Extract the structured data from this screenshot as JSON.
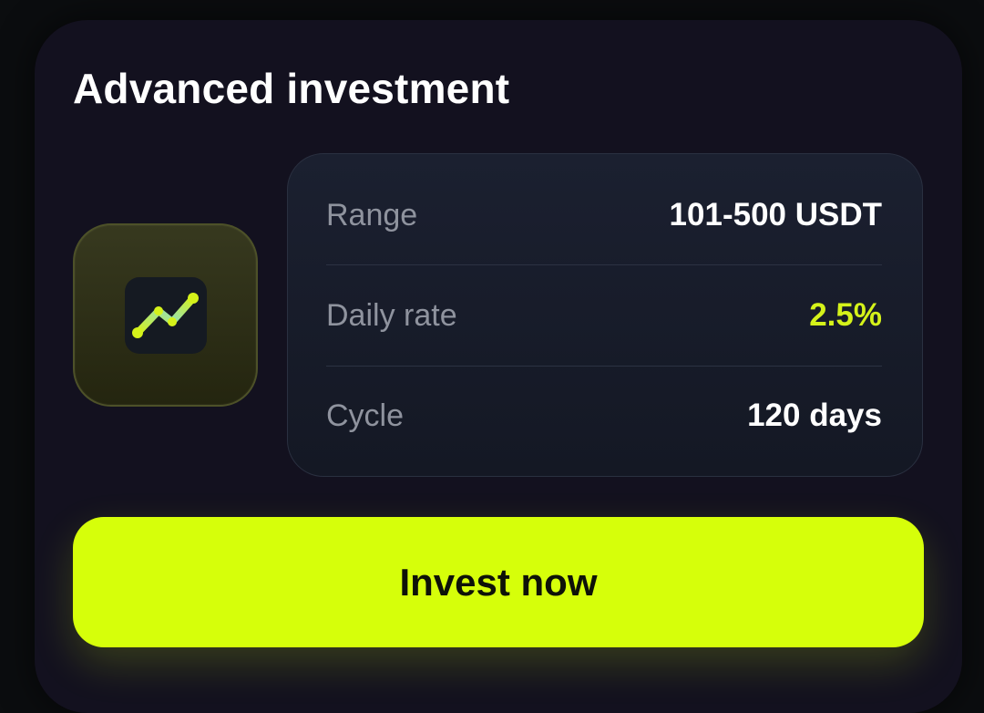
{
  "card": {
    "title": "Advanced investment"
  },
  "icon": {
    "name": "trend-chart-icon",
    "color": "#d5f21a"
  },
  "details": {
    "range_label": "Range",
    "range_value": "101-500 USDT",
    "daily_rate_label": "Daily rate",
    "daily_rate_value": "2.5%",
    "cycle_label": "Cycle",
    "cycle_value": "120 days"
  },
  "actions": {
    "invest_label": "Invest now"
  },
  "colors": {
    "accent": "#d6ff0a",
    "card_background": "#13111f",
    "page_background": "#0b0d0f"
  }
}
